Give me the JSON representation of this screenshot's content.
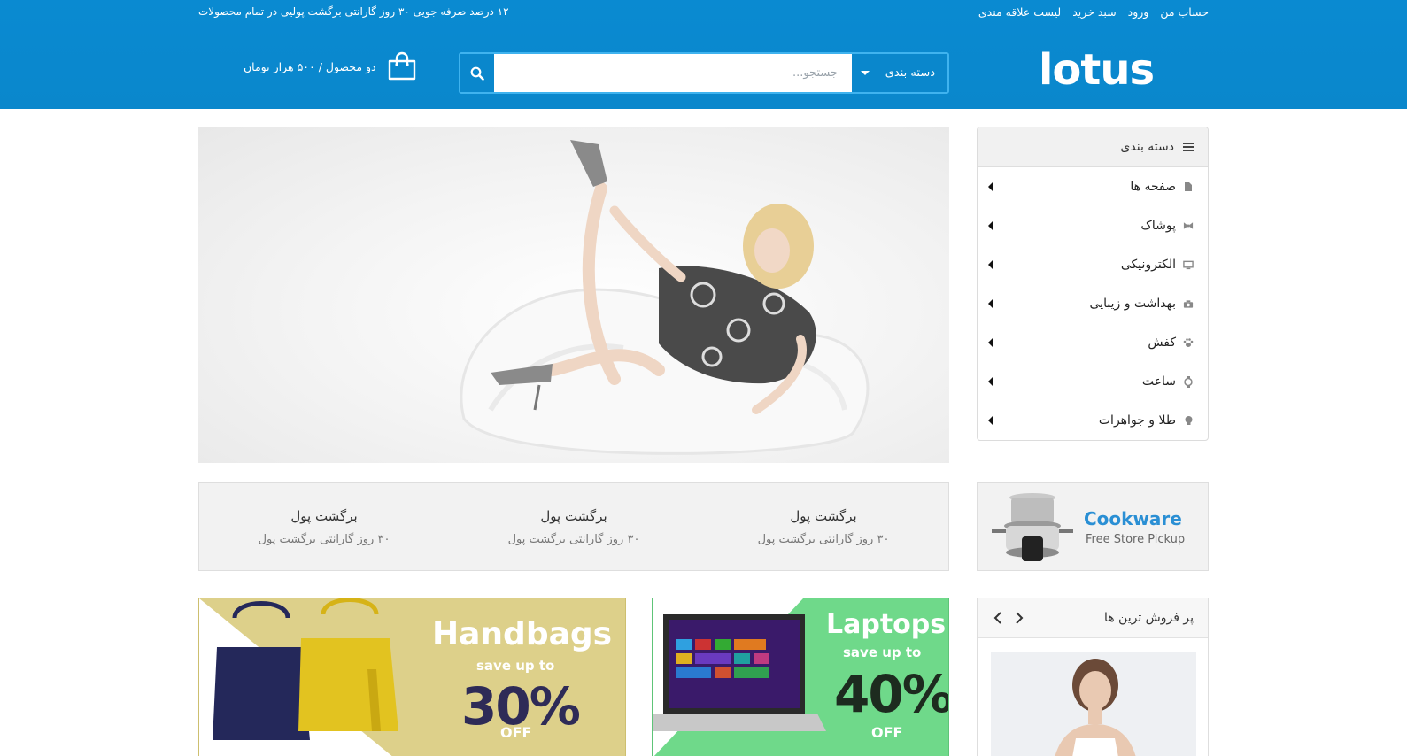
{
  "topbar": {
    "promo": "۱۲ درصد صرفه جویی ۳۰ روز گارانتی برگشت پولیی در تمام محصولات",
    "links": [
      "حساب من",
      "ورود",
      "سبد خرید",
      "لیست علاقه مندی"
    ]
  },
  "header": {
    "logo": "lotus",
    "search_placeholder": "جستجو...",
    "category_select": "دسته بندی",
    "cart_text": "دو محصول / ۵۰۰ هزار تومان"
  },
  "category_menu": {
    "title": "دسته بندی",
    "items": [
      {
        "label": "صفحه ها",
        "icon": "file-icon"
      },
      {
        "label": "پوشاک",
        "icon": "bow-tie-icon"
      },
      {
        "label": "الکترونیکی",
        "icon": "monitor-icon"
      },
      {
        "label": "بهداشت و زیبایی",
        "icon": "camera-icon"
      },
      {
        "label": "کفش",
        "icon": "paw-icon"
      },
      {
        "label": "ساعت",
        "icon": "watch-icon"
      },
      {
        "label": "طلا و جواهرات",
        "icon": "gem-icon"
      }
    ]
  },
  "cookware": {
    "title": "Cookware",
    "subtitle": "Free Store Pickup"
  },
  "features": [
    {
      "title": "برگشت پول",
      "subtitle": "۳۰ روز گارانتی برگشت پول"
    },
    {
      "title": "برگشت پول",
      "subtitle": "۳۰ روز گارانتی برگشت پول"
    },
    {
      "title": "برگشت پول",
      "subtitle": "۳۰ روز گارانتی برگشت پول"
    }
  ],
  "banners": {
    "handbags": {
      "title": "Handbags",
      "save": "save up to",
      "percent": "30%",
      "off": "OFF"
    },
    "laptops": {
      "title": "Laptops",
      "save": "save up to",
      "percent": "40%",
      "off": "OFF"
    }
  },
  "bestsellers": {
    "title": "پر فروش ترین ها"
  },
  "colors": {
    "brand_blue": "#0a87cc",
    "handbag_bg": "#ddd08a",
    "laptop_bg": "#6fd98a"
  }
}
